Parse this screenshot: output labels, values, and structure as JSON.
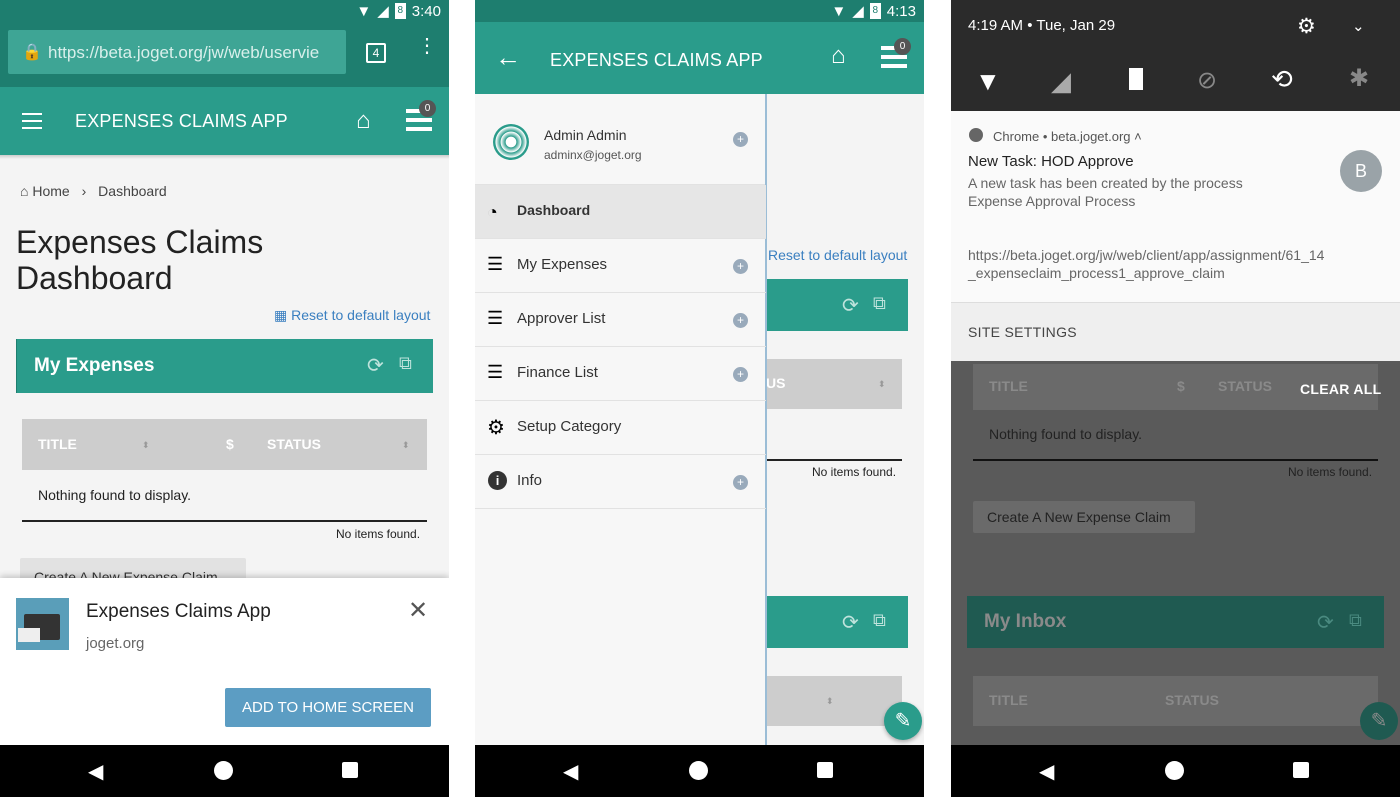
{
  "colors": {
    "teal": "#2a9c8b",
    "dark_teal": "#21887a",
    "statusbar": "#1e7e6f",
    "blue_btn": "#5c9dc3"
  },
  "panel1": {
    "status": {
      "time": "3:40",
      "battery": "8"
    },
    "url": {
      "text": "https://beta.joget.org/jw/web/uservie",
      "tabs": "4"
    },
    "appbar": {
      "title": "EXPENSES CLAIMS APP",
      "inbox_count": "0"
    },
    "breadcrumb": {
      "home": "Home",
      "sep": "›",
      "current": "Dashboard"
    },
    "page_title": "Expenses Claims Dashboard",
    "reset_layout": "Reset to default layout",
    "widget": {
      "title": "My Expenses",
      "columns": [
        "TITLE",
        "$",
        "STATUS"
      ],
      "empty": "Nothing found to display.",
      "no_items": "No items found."
    },
    "create_button": "Create A New Expense Claim",
    "a2hs": {
      "title": "Expenses Claims App",
      "domain": "joget.org",
      "button": "ADD TO HOME SCREEN"
    }
  },
  "panel2": {
    "status": {
      "time": "4:13",
      "battery": "8"
    },
    "appbar": {
      "title": "EXPENSES CLAIMS APP",
      "inbox_count": "0"
    },
    "user": {
      "name": "Admin Admin",
      "email": "adminx@joget.org"
    },
    "menu": [
      {
        "label": "Dashboard",
        "icon": "dashboard-icon",
        "active": true,
        "plus": false
      },
      {
        "label": "My Expenses",
        "icon": "list-icon",
        "active": false,
        "plus": true
      },
      {
        "label": "Approver List",
        "icon": "list-icon",
        "active": false,
        "plus": true
      },
      {
        "label": "Finance List",
        "icon": "list-icon",
        "active": false,
        "plus": true
      },
      {
        "label": "Setup Category",
        "icon": "gear-icon",
        "active": false,
        "plus": false
      },
      {
        "label": "Info",
        "icon": "info-icon",
        "active": false,
        "plus": true
      }
    ],
    "bg": {
      "reset_layout": "Reset to default layout",
      "status_col": "US",
      "no_items": "No items found."
    }
  },
  "panel3": {
    "shade": {
      "time": "4:19 AM",
      "date": "Tue, Jan 29"
    },
    "notification": {
      "app": "Chrome",
      "site": "beta.joget.org",
      "title": "New Task: HOD Approve",
      "body1": "A new task has been created by the process",
      "body2": "Expense Approval Process",
      "url1": "https://beta.joget.org/jw/web/client/app/assignment/61_14",
      "url2": "_expenseclaim_process1_approve_claim",
      "avatar": "B"
    },
    "site_settings": "SITE SETTINGS",
    "clear_all": "CLEAR ALL",
    "bg": {
      "columns": [
        "TITLE",
        "$",
        "STATUS"
      ],
      "empty": "Nothing found to display.",
      "no_items": "No items found.",
      "create_button": "Create A New Expense Claim",
      "inbox_title": "My Inbox",
      "inbox_columns": [
        "TITLE",
        "STATUS"
      ]
    }
  }
}
